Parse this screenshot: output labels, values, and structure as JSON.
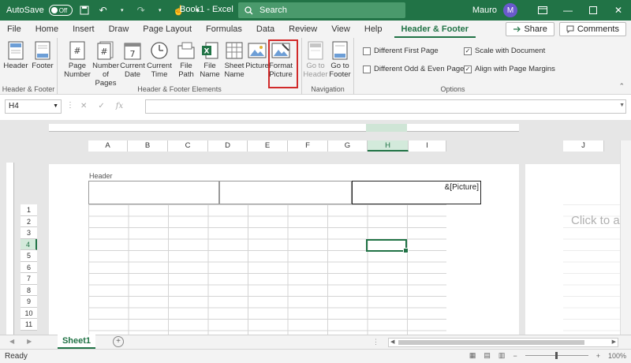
{
  "titlebar": {
    "autosave_label": "AutoSave",
    "autosave_state": "Off",
    "title": "Book1 - Excel",
    "search_placeholder": "Search",
    "user_name": "Mauro",
    "avatar_initial": "M"
  },
  "tabs": [
    "File",
    "Home",
    "Insert",
    "Draw",
    "Page Layout",
    "Formulas",
    "Data",
    "Review",
    "View",
    "Help",
    "Header & Footer"
  ],
  "active_tab": "Header & Footer",
  "share_label": "Share",
  "comments_label": "Comments",
  "ribbon": {
    "groups": {
      "hf": "Header & Footer",
      "elements": "Header & Footer Elements",
      "navigation": "Navigation",
      "options": "Options"
    },
    "hf_buttons": [
      {
        "label": "Header",
        "icon": "header-icon"
      },
      {
        "label": "Footer",
        "icon": "footer-icon"
      }
    ],
    "element_buttons": [
      {
        "label": "Page\nNumber",
        "icon": "page-number-icon"
      },
      {
        "label": "Number\nof Pages",
        "icon": "number-of-pages-icon"
      },
      {
        "label": "Current\nDate",
        "icon": "calendar-icon"
      },
      {
        "label": "Current\nTime",
        "icon": "clock-icon"
      },
      {
        "label": "File\nPath",
        "icon": "file-path-icon"
      },
      {
        "label": "File\nName",
        "icon": "excel-file-icon"
      },
      {
        "label": "Sheet\nName",
        "icon": "sheet-icon"
      },
      {
        "label": "Picture",
        "icon": "picture-icon"
      },
      {
        "label": "Format\nPicture",
        "icon": "format-picture-icon"
      }
    ],
    "nav_buttons": [
      {
        "label": "Go to\nHeader",
        "icon": "go-to-header-icon",
        "disabled": true
      },
      {
        "label": "Go to\nFooter",
        "icon": "go-to-footer-icon",
        "disabled": false
      }
    ],
    "options": [
      {
        "label": "Different First Page",
        "checked": false
      },
      {
        "label": "Different Odd & Even Pages",
        "checked": false
      },
      {
        "label": "Scale with Document",
        "checked": true
      },
      {
        "label": "Align with Page Margins",
        "checked": true
      }
    ]
  },
  "formula_bar": {
    "name_box": "H4",
    "formula": ""
  },
  "sheet": {
    "columns": [
      "A",
      "B",
      "C",
      "D",
      "E",
      "F",
      "G",
      "H",
      "I"
    ],
    "extra_column": "J",
    "selected_column": "H",
    "rows": [
      "1",
      "2",
      "3",
      "4",
      "5",
      "6",
      "7",
      "8",
      "9",
      "10",
      "11"
    ],
    "selected_row": "4",
    "header_label": "Header",
    "header_right_text": "&[Picture]",
    "click_to_add": "Click to a"
  },
  "sheet_tabs": [
    "Sheet1"
  ],
  "status": {
    "text": "Ready",
    "zoom": "100%"
  },
  "colors": {
    "accent": "#217346",
    "highlight": "#d12a2a"
  }
}
